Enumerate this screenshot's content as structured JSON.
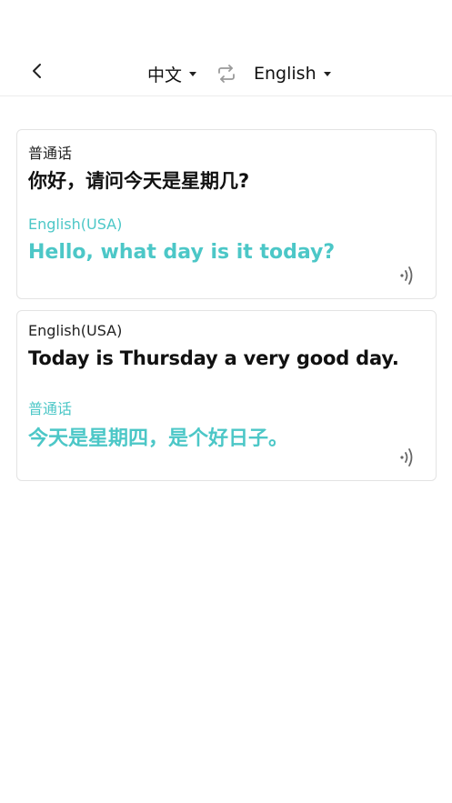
{
  "header": {
    "back_icon": "chevron-left-icon",
    "source_language": "中文",
    "target_language": "English",
    "swap_icon": "swap-icon"
  },
  "colors": {
    "accent": "#4cc7c7",
    "text": "#111111",
    "border": "#e3e3e3"
  },
  "translations": [
    {
      "source_language": "普通话",
      "source_text": "你好，请问今天是星期几?",
      "target_language": "English(USA)",
      "target_text": "Hello, what day is it today?",
      "play_icon": "speaker-icon"
    },
    {
      "source_language": "English(USA)",
      "source_text": "Today is Thursday a very good day.",
      "target_language": "普通话",
      "target_text": "今天是星期四，是个好日子。",
      "play_icon": "speaker-icon"
    }
  ]
}
